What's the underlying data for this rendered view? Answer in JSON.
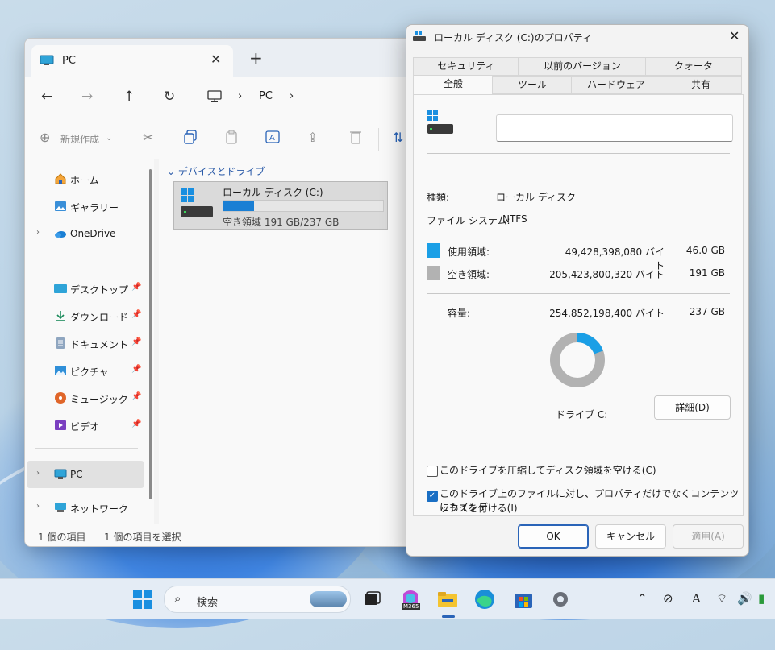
{
  "explorer": {
    "tab_title": "PC",
    "new_tab": "+",
    "breadcrumb": [
      "PC"
    ],
    "new_button": "新規作成",
    "sidebar": {
      "items": [
        {
          "label": "ホーム",
          "icon": "home-icon"
        },
        {
          "label": "ギャラリー",
          "icon": "gallery-icon"
        },
        {
          "label": "OneDrive",
          "icon": "onedrive-icon"
        },
        {
          "label": "デスクトップ",
          "icon": "desktop-icon"
        },
        {
          "label": "ダウンロード",
          "icon": "download-icon"
        },
        {
          "label": "ドキュメント",
          "icon": "documents-icon"
        },
        {
          "label": "ピクチャ",
          "icon": "pictures-icon"
        },
        {
          "label": "ミュージック",
          "icon": "music-icon"
        },
        {
          "label": "ビデオ",
          "icon": "videos-icon"
        },
        {
          "label": "PC",
          "icon": "pc-icon"
        },
        {
          "label": "ネットワーク",
          "icon": "network-icon"
        }
      ]
    },
    "group_header": "デバイスとドライブ",
    "drive": {
      "name": "ローカル ディスク (C:)",
      "free_text": "空き領域 191 GB/237 GB",
      "used_fraction": 0.19
    },
    "status": {
      "count": "1 個の項目",
      "selected": "1 個の項目を選択"
    }
  },
  "dialog": {
    "title": "ローカル ディスク (C:)のプロパティ",
    "tabs_top": [
      "セキュリティ",
      "以前のバージョン",
      "クォータ"
    ],
    "tabs_bottom": [
      "全般",
      "ツール",
      "ハードウェア",
      "共有"
    ],
    "active_tab": "全般",
    "type_label": "種類:",
    "type_value": "ローカル ディスク",
    "fs_label": "ファイル システム:",
    "fs_value": "NTFS",
    "used_label": "使用領域:",
    "used_bytes": "49,428,398,080 バイト",
    "used_gb": "46.0 GB",
    "free_label": "空き領域:",
    "free_bytes": "205,423,800,320 バイト",
    "free_gb": "191 GB",
    "capacity_label": "容量:",
    "capacity_bytes": "254,852,198,400 バイト",
    "capacity_gb": "237 GB",
    "drive_label": "ドライブ C:",
    "details_button": "詳細(D)",
    "compress_label": "このドライブを圧縮してディスク領域を空ける(C)",
    "compress_checked": false,
    "index_label_1": "このドライブ上のファイルに対し、プロパティだけでなくコンテンツにもインデ",
    "index_label_2": "ックスを付ける(I)",
    "index_checked": true,
    "ok": "OK",
    "cancel": "キャンセル",
    "apply": "適用(A)",
    "used_color": "#1a9fe6",
    "free_color": "#b2b2b2",
    "used_fraction": 0.194
  },
  "taskbar": {
    "search_placeholder": "検索",
    "m365_badge": "M365"
  }
}
